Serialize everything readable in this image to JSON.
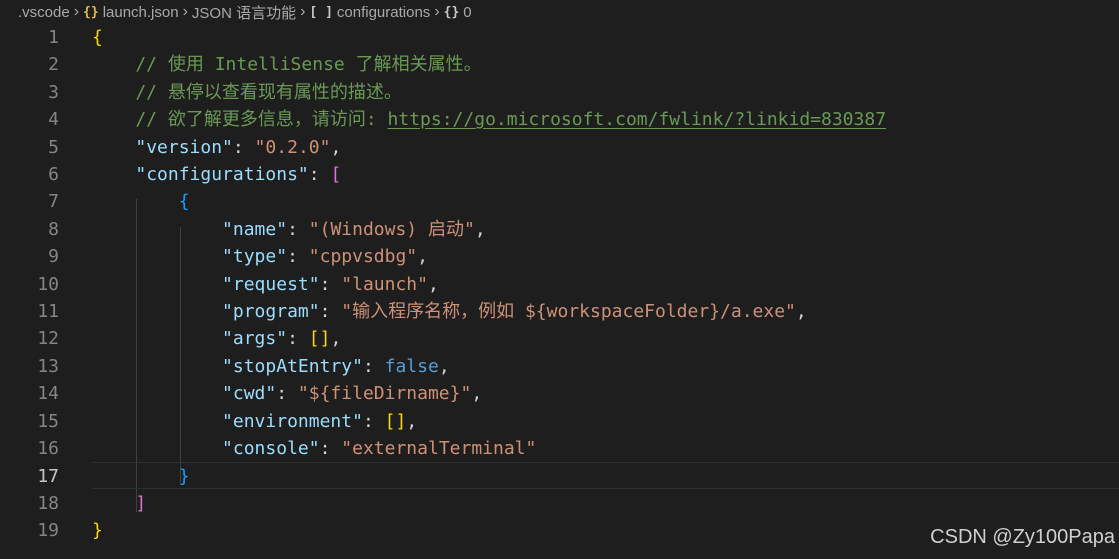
{
  "breadcrumb": {
    "folder": ".vscode",
    "file_icon": "{}",
    "file": "launch.json",
    "schema": "JSON 语言功能",
    "array_icon": "[ ]",
    "node": "configurations",
    "obj_icon": "{}",
    "index": "0"
  },
  "lines": [
    {
      "n": "1",
      "parts": [
        {
          "c": "b1",
          "t": "{"
        }
      ]
    },
    {
      "n": "2",
      "parts": [
        {
          "c": "cm",
          "t": "    // 使用 IntelliSense 了解相关属性。"
        }
      ]
    },
    {
      "n": "3",
      "parts": [
        {
          "c": "cm",
          "t": "    // 悬停以查看现有属性的描述。"
        }
      ]
    },
    {
      "n": "4",
      "parts": [
        {
          "c": "cm",
          "t": "    // 欲了解更多信息，请访问: "
        },
        {
          "c": "link",
          "t": "https://go.microsoft.com/fwlink/?linkid=830387"
        }
      ]
    },
    {
      "n": "5",
      "parts": [
        {
          "c": "punc",
          "t": "    "
        },
        {
          "c": "key",
          "t": "\"version\""
        },
        {
          "c": "punc",
          "t": ": "
        },
        {
          "c": "str",
          "t": "\"0.2.0\""
        },
        {
          "c": "punc",
          "t": ","
        }
      ]
    },
    {
      "n": "6",
      "parts": [
        {
          "c": "punc",
          "t": "    "
        },
        {
          "c": "key",
          "t": "\"configurations\""
        },
        {
          "c": "punc",
          "t": ": "
        },
        {
          "c": "b2",
          "t": "["
        }
      ]
    },
    {
      "n": "7",
      "parts": [
        {
          "c": "punc",
          "t": "        "
        },
        {
          "c": "b3",
          "t": "{"
        }
      ]
    },
    {
      "n": "8",
      "parts": [
        {
          "c": "punc",
          "t": "            "
        },
        {
          "c": "key",
          "t": "\"name\""
        },
        {
          "c": "punc",
          "t": ": "
        },
        {
          "c": "str",
          "t": "\"(Windows) 启动\""
        },
        {
          "c": "punc",
          "t": ","
        }
      ]
    },
    {
      "n": "9",
      "parts": [
        {
          "c": "punc",
          "t": "            "
        },
        {
          "c": "key",
          "t": "\"type\""
        },
        {
          "c": "punc",
          "t": ": "
        },
        {
          "c": "str",
          "t": "\"cppvsdbg\""
        },
        {
          "c": "punc",
          "t": ","
        }
      ]
    },
    {
      "n": "10",
      "parts": [
        {
          "c": "punc",
          "t": "            "
        },
        {
          "c": "key",
          "t": "\"request\""
        },
        {
          "c": "punc",
          "t": ": "
        },
        {
          "c": "str",
          "t": "\"launch\""
        },
        {
          "c": "punc",
          "t": ","
        }
      ]
    },
    {
      "n": "11",
      "parts": [
        {
          "c": "punc",
          "t": "            "
        },
        {
          "c": "key",
          "t": "\"program\""
        },
        {
          "c": "punc",
          "t": ": "
        },
        {
          "c": "str",
          "t": "\"输入程序名称，例如 ${workspaceFolder}/a.exe\""
        },
        {
          "c": "punc",
          "t": ","
        }
      ]
    },
    {
      "n": "12",
      "parts": [
        {
          "c": "punc",
          "t": "            "
        },
        {
          "c": "key",
          "t": "\"args\""
        },
        {
          "c": "punc",
          "t": ": "
        },
        {
          "c": "b1",
          "t": "[]"
        },
        {
          "c": "punc",
          "t": ","
        }
      ]
    },
    {
      "n": "13",
      "parts": [
        {
          "c": "punc",
          "t": "            "
        },
        {
          "c": "key",
          "t": "\"stopAtEntry\""
        },
        {
          "c": "punc",
          "t": ": "
        },
        {
          "c": "kw",
          "t": "false"
        },
        {
          "c": "punc",
          "t": ","
        }
      ]
    },
    {
      "n": "14",
      "parts": [
        {
          "c": "punc",
          "t": "            "
        },
        {
          "c": "key",
          "t": "\"cwd\""
        },
        {
          "c": "punc",
          "t": ": "
        },
        {
          "c": "str",
          "t": "\"${fileDirname}\""
        },
        {
          "c": "punc",
          "t": ","
        }
      ]
    },
    {
      "n": "15",
      "parts": [
        {
          "c": "punc",
          "t": "            "
        },
        {
          "c": "key",
          "t": "\"environment\""
        },
        {
          "c": "punc",
          "t": ": "
        },
        {
          "c": "b1",
          "t": "[]"
        },
        {
          "c": "punc",
          "t": ","
        }
      ]
    },
    {
      "n": "16",
      "parts": [
        {
          "c": "punc",
          "t": "            "
        },
        {
          "c": "key",
          "t": "\"console\""
        },
        {
          "c": "punc",
          "t": ": "
        },
        {
          "c": "str",
          "t": "\"externalTerminal\""
        }
      ]
    },
    {
      "n": "17",
      "parts": [
        {
          "c": "punc",
          "t": "        "
        },
        {
          "c": "b3",
          "t": "}"
        }
      ]
    },
    {
      "n": "18",
      "parts": [
        {
          "c": "punc",
          "t": "    "
        },
        {
          "c": "b2",
          "t": "]"
        }
      ]
    },
    {
      "n": "19",
      "parts": [
        {
          "c": "b1",
          "t": "}"
        }
      ]
    }
  ],
  "current_line": "17",
  "watermark": "CSDN @Zy100Papa"
}
